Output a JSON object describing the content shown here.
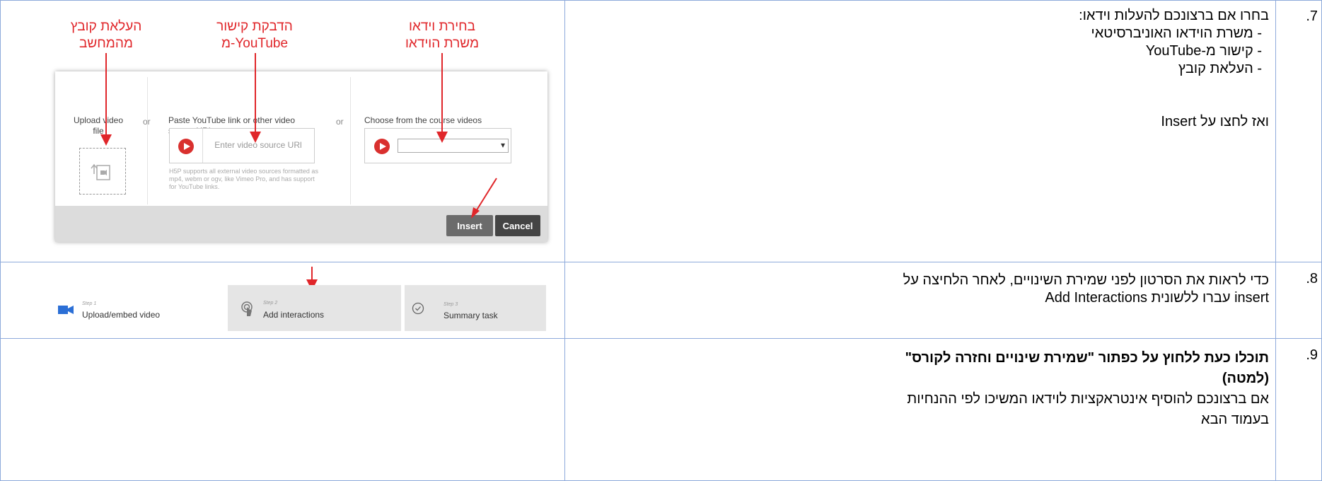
{
  "rows": [
    {
      "number": ".7",
      "lines": [
        "בחרו אם ברצונכם להעלות וידאו:",
        "-      משרת הוידאו האוניברסיטאי",
        "-      קישור מ-YouTube",
        "-      העלאת קובץ",
        "ואז לחצו על Insert"
      ]
    },
    {
      "number": ".8",
      "lines": [
        "כדי לראות את הסרטון לפני שמירת השינויים, לאחר הלחיצה על",
        "insert עברו ללשונית Add Interactions"
      ]
    },
    {
      "number": ".9",
      "bold_line1": "תוכלו כעת ללחוץ על כפתור \"שמירת שינויים וחזרה לקורס\"",
      "bold_line2": "(למטה)",
      "lines": [
        "אם ברצונכם להוסיף אינטראקציות לוידאו המשיכו לפי ההנחיות",
        "בעמוד הבא"
      ]
    }
  ],
  "annotations": {
    "upload": [
      "העלאת קובץ",
      "מהמחשב"
    ],
    "youtube": [
      "הדבקת קישור",
      "מ-YouTube"
    ],
    "server": [
      "בחירת וידאו",
      "משרת הוידאו"
    ]
  },
  "dialog": {
    "upload_title": "Upload video file",
    "or": "or",
    "paste_title": "Paste YouTube link or other video source URL",
    "url_placeholder": "Enter video source URl",
    "hint": "H5P supports all external video sources formatted as mp4, webm or ogv, like Vimeo Pro, and has support for YouTube links.",
    "choose_title": "Choose from the course videos",
    "select_arrow": "▾",
    "insert_label": "Insert",
    "cancel_label": "Cancel"
  },
  "steps": [
    {
      "label": "Step 1",
      "name": "Upload/embed video"
    },
    {
      "label": "Step 2",
      "name": "Add interactions"
    },
    {
      "label": "Step 3",
      "name": "Summary task"
    }
  ],
  "colors": {
    "annotation": "#e0262a",
    "border": "#8eaadb",
    "insert_button": "#6b6b6b",
    "cancel_button": "#444444",
    "video_blue": "#2b6fd6"
  }
}
